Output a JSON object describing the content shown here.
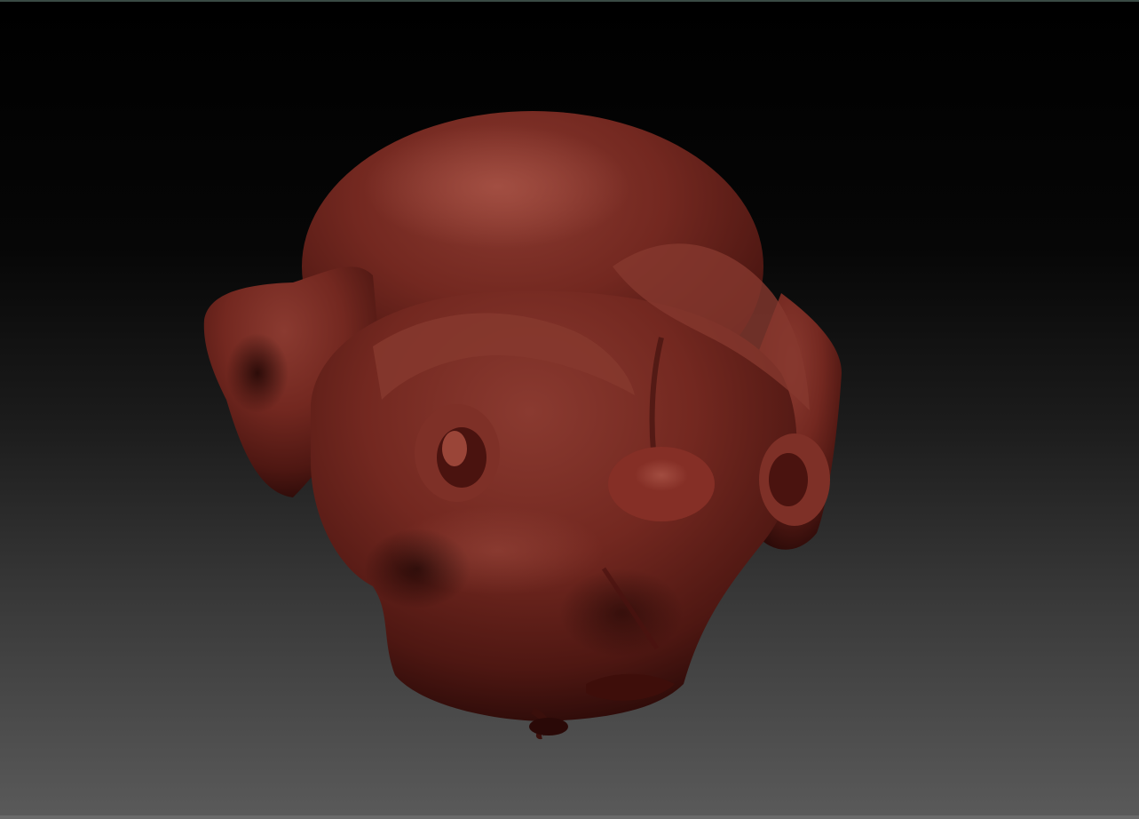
{
  "app": {
    "viewport": "3d-sculpt-canvas"
  },
  "scene": {
    "model": "sculpted-creature-head",
    "material_color": "#7a2a22",
    "background_top": "#000000",
    "background_bottom": "#5a5a5a"
  }
}
